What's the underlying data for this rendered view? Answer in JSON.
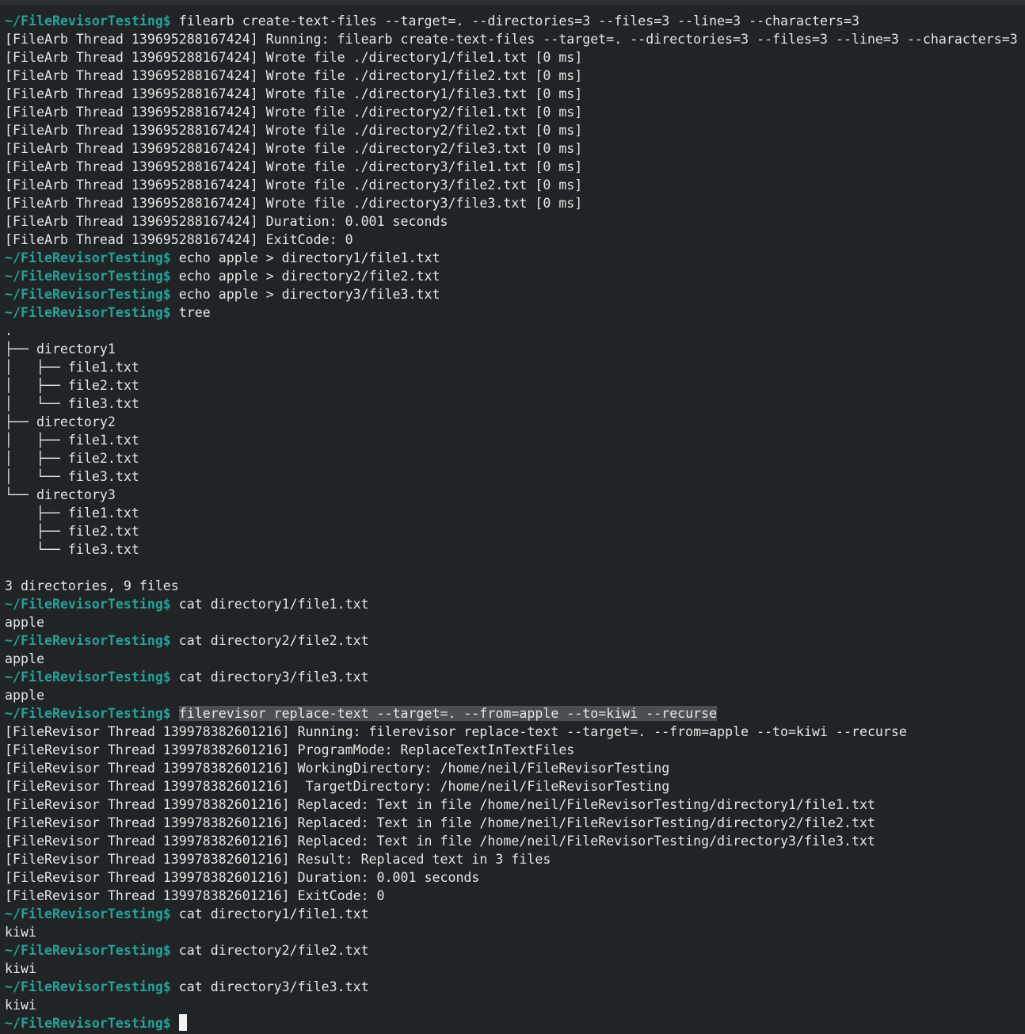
{
  "terminal": {
    "prompt": "~/FileRevisorTesting$",
    "lines": [
      {
        "kind": "cmd",
        "text": "filearb create-text-files --target=. --directories=3 --files=3 --line=3 --characters=3"
      },
      {
        "kind": "out",
        "text": "[FileArb Thread 139695288167424] Running: filearb create-text-files --target=. --directories=3 --files=3 --line=3 --characters=3"
      },
      {
        "kind": "out",
        "text": "[FileArb Thread 139695288167424] Wrote file ./directory1/file1.txt [0 ms]"
      },
      {
        "kind": "out",
        "text": "[FileArb Thread 139695288167424] Wrote file ./directory1/file2.txt [0 ms]"
      },
      {
        "kind": "out",
        "text": "[FileArb Thread 139695288167424] Wrote file ./directory1/file3.txt [0 ms]"
      },
      {
        "kind": "out",
        "text": "[FileArb Thread 139695288167424] Wrote file ./directory2/file1.txt [0 ms]"
      },
      {
        "kind": "out",
        "text": "[FileArb Thread 139695288167424] Wrote file ./directory2/file2.txt [0 ms]"
      },
      {
        "kind": "out",
        "text": "[FileArb Thread 139695288167424] Wrote file ./directory2/file3.txt [0 ms]"
      },
      {
        "kind": "out",
        "text": "[FileArb Thread 139695288167424] Wrote file ./directory3/file1.txt [0 ms]"
      },
      {
        "kind": "out",
        "text": "[FileArb Thread 139695288167424] Wrote file ./directory3/file2.txt [0 ms]"
      },
      {
        "kind": "out",
        "text": "[FileArb Thread 139695288167424] Wrote file ./directory3/file3.txt [0 ms]"
      },
      {
        "kind": "out",
        "text": "[FileArb Thread 139695288167424] Duration: 0.001 seconds"
      },
      {
        "kind": "out",
        "text": "[FileArb Thread 139695288167424] ExitCode: 0"
      },
      {
        "kind": "cmd",
        "text": "echo apple > directory1/file1.txt"
      },
      {
        "kind": "cmd",
        "text": "echo apple > directory2/file2.txt"
      },
      {
        "kind": "cmd",
        "text": "echo apple > directory3/file3.txt"
      },
      {
        "kind": "cmd",
        "text": "tree"
      },
      {
        "kind": "out",
        "text": "."
      },
      {
        "kind": "out",
        "text": "├── directory1"
      },
      {
        "kind": "out",
        "text": "│   ├── file1.txt"
      },
      {
        "kind": "out",
        "text": "│   ├── file2.txt"
      },
      {
        "kind": "out",
        "text": "│   └── file3.txt"
      },
      {
        "kind": "out",
        "text": "├── directory2"
      },
      {
        "kind": "out",
        "text": "│   ├── file1.txt"
      },
      {
        "kind": "out",
        "text": "│   ├── file2.txt"
      },
      {
        "kind": "out",
        "text": "│   └── file3.txt"
      },
      {
        "kind": "out",
        "text": "└── directory3"
      },
      {
        "kind": "out",
        "text": "    ├── file1.txt"
      },
      {
        "kind": "out",
        "text": "    ├── file2.txt"
      },
      {
        "kind": "out",
        "text": "    └── file3.txt"
      },
      {
        "kind": "out",
        "text": ""
      },
      {
        "kind": "out",
        "text": "3 directories, 9 files"
      },
      {
        "kind": "cmd",
        "text": "cat directory1/file1.txt"
      },
      {
        "kind": "out",
        "text": "apple"
      },
      {
        "kind": "cmd",
        "text": "cat directory2/file2.txt"
      },
      {
        "kind": "out",
        "text": "apple"
      },
      {
        "kind": "cmd",
        "text": "cat directory3/file3.txt"
      },
      {
        "kind": "out",
        "text": "apple"
      },
      {
        "kind": "cmd",
        "text": "filerevisor replace-text --target=. --from=apple --to=kiwi --recurse",
        "selected": true
      },
      {
        "kind": "out",
        "text": "[FileRevisor Thread 139978382601216] Running: filerevisor replace-text --target=. --from=apple --to=kiwi --recurse"
      },
      {
        "kind": "out",
        "text": "[FileRevisor Thread 139978382601216] ProgramMode: ReplaceTextInTextFiles"
      },
      {
        "kind": "out",
        "text": "[FileRevisor Thread 139978382601216] WorkingDirectory: /home/neil/FileRevisorTesting"
      },
      {
        "kind": "out",
        "text": "[FileRevisor Thread 139978382601216]  TargetDirectory: /home/neil/FileRevisorTesting"
      },
      {
        "kind": "out",
        "text": "[FileRevisor Thread 139978382601216] Replaced: Text in file /home/neil/FileRevisorTesting/directory1/file1.txt"
      },
      {
        "kind": "out",
        "text": "[FileRevisor Thread 139978382601216] Replaced: Text in file /home/neil/FileRevisorTesting/directory2/file2.txt"
      },
      {
        "kind": "out",
        "text": "[FileRevisor Thread 139978382601216] Replaced: Text in file /home/neil/FileRevisorTesting/directory3/file3.txt"
      },
      {
        "kind": "out",
        "text": "[FileRevisor Thread 139978382601216] Result: Replaced text in 3 files"
      },
      {
        "kind": "out",
        "text": "[FileRevisor Thread 139978382601216] Duration: 0.001 seconds"
      },
      {
        "kind": "out",
        "text": "[FileRevisor Thread 139978382601216] ExitCode: 0"
      },
      {
        "kind": "cmd",
        "text": "cat directory1/file1.txt"
      },
      {
        "kind": "out",
        "text": "kiwi"
      },
      {
        "kind": "cmd",
        "text": "cat directory2/file2.txt"
      },
      {
        "kind": "out",
        "text": "kiwi"
      },
      {
        "kind": "cmd",
        "text": "cat directory3/file3.txt"
      },
      {
        "kind": "out",
        "text": "kiwi"
      },
      {
        "kind": "input",
        "text": ""
      }
    ]
  },
  "colors": {
    "background": "#202426",
    "prompt": "#2aa198",
    "text": "#e3e6e4",
    "selection": "#4a4f51"
  }
}
